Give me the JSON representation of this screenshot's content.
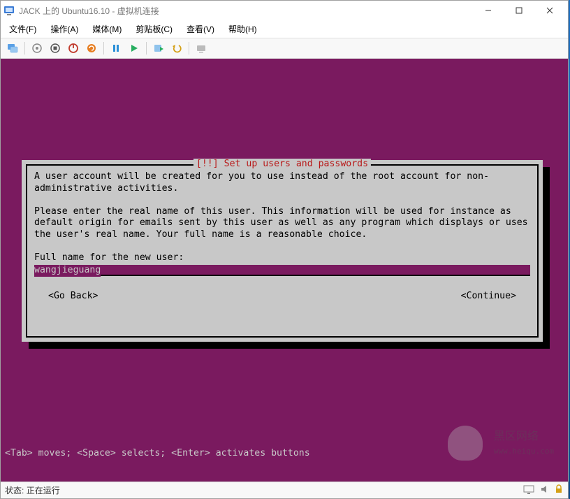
{
  "window": {
    "title": "JACK 上的 Ubuntu16.10 - 虚拟机连接",
    "controls": {
      "minimize": "—",
      "maximize": "□",
      "close": "×"
    }
  },
  "menu": {
    "file": "文件(F)",
    "action": "操作(A)",
    "media": "媒体(M)",
    "clipboard": "剪贴板(C)",
    "view": "查看(V)",
    "help": "帮助(H)"
  },
  "toolbar_icons": {
    "connect": "connect-icon",
    "start_grey": "start-grey-icon",
    "stop": "stop-icon",
    "shutdown": "shutdown-icon",
    "reset": "reset-icon",
    "pause": "pause-icon",
    "play": "play-icon",
    "checkpoint": "checkpoint-icon",
    "revert": "revert-icon",
    "share": "share-icon"
  },
  "dialog": {
    "title": "[!!] Set up users and passwords",
    "text_1": "A user account will be created for you to use instead of the root account for non-administrative activities.",
    "text_2": "Please enter the real name of this user. This information will be used for instance as default origin for emails sent by this user as well as any program which displays or uses the user's real name. Your full name is a reasonable choice.",
    "prompt": "Full name for the new user:",
    "input_value": "wangjieguang",
    "go_back": "<Go Back>",
    "continue": "<Continue>"
  },
  "hint": "<Tab> moves; <Space> selects; <Enter> activates buttons",
  "status": {
    "label": "状态:",
    "value": "正在运行"
  },
  "watermark": {
    "text1": "黑区网络",
    "text2": "www.heiqu.com"
  },
  "colors": {
    "vm_bg": "#7a1a5f",
    "dialog_bg": "#c8c8c8",
    "title_red": "#b81818"
  }
}
